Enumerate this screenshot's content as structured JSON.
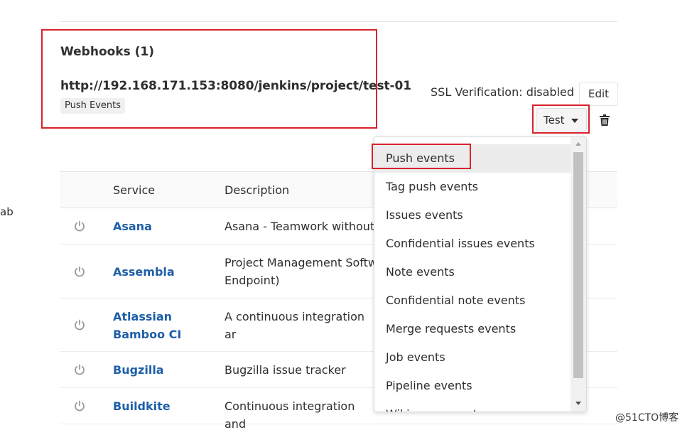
{
  "left_clip_text": "ab",
  "webhooks": {
    "title": "Webhooks (1)",
    "url": "http://192.168.171.153:8080/jenkins/project/test-01",
    "event_badge": "Push Events",
    "ssl_text": "SSL Verification: disabled",
    "edit_label": "Edit",
    "test_label": "Test",
    "delete_icon": "trash-icon"
  },
  "services_table": {
    "headers": [
      "Service",
      "Description"
    ],
    "rows": [
      {
        "name": "Asana",
        "description": "Asana - Teamwork without"
      },
      {
        "name": "Assembla",
        "description": "Project Management Softw\nEndpoint)"
      },
      {
        "name": "Atlassian Bamboo CI",
        "description": "A continuous integration ar"
      },
      {
        "name": "Bugzilla",
        "description": "Bugzilla issue tracker"
      },
      {
        "name": "Buildkite",
        "description": "Continuous integration and"
      }
    ],
    "status_icon": "power-icon"
  },
  "test_dropdown": {
    "items": [
      "Push events",
      "Tag push events",
      "Issues events",
      "Confidential issues events",
      "Note events",
      "Confidential note events",
      "Merge requests events",
      "Job events",
      "Pipeline events",
      "Wiki page events"
    ],
    "active_index": 0
  },
  "watermark": "@51CTO博客",
  "colors": {
    "highlight_border": "#d9222a",
    "link": "#1f5fa8"
  }
}
